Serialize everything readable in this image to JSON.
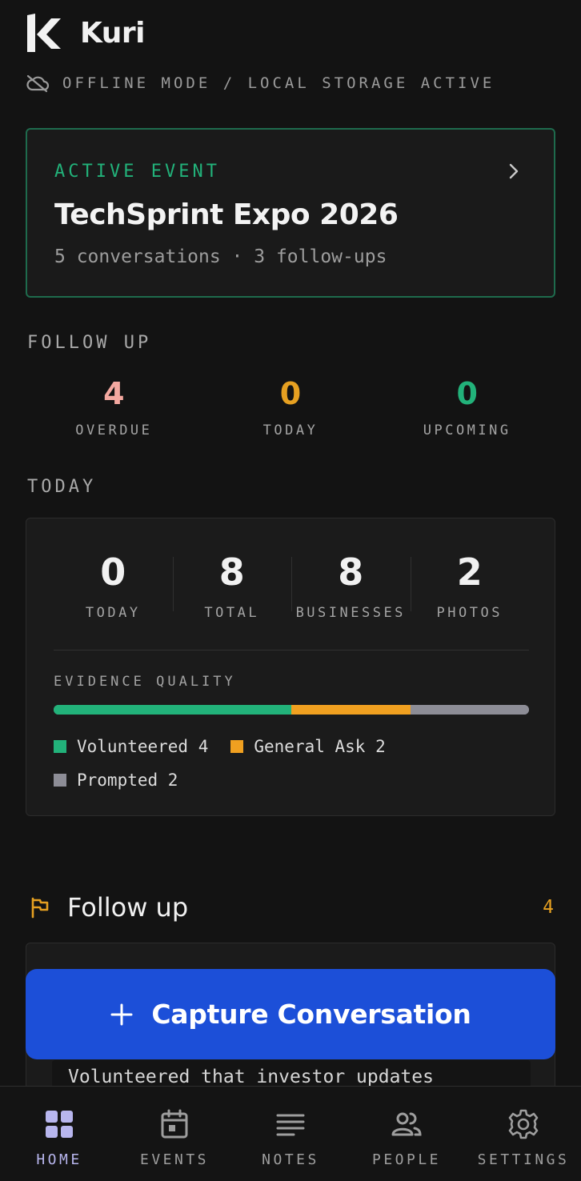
{
  "app": {
    "name": "Kuri"
  },
  "status": {
    "offline_text": "OFFLINE MODE / LOCAL STORAGE ACTIVE"
  },
  "active_event": {
    "eyebrow": "ACTIVE EVENT",
    "title": "TechSprint Expo 2026",
    "meta": "5 conversations · 3 follow-ups"
  },
  "follow_up_summary": {
    "label": "FOLLOW UP",
    "stats": [
      {
        "value": "4",
        "label": "OVERDUE",
        "color": "#f4a8a0"
      },
      {
        "value": "0",
        "label": "TODAY",
        "color": "#e6a021"
      },
      {
        "value": "0",
        "label": "UPCOMING",
        "color": "#22b27a"
      }
    ]
  },
  "today": {
    "label": "TODAY",
    "stats": [
      {
        "value": "0",
        "label": "TODAY"
      },
      {
        "value": "8",
        "label": "TOTAL"
      },
      {
        "value": "8",
        "label": "BUSINESSES"
      },
      {
        "value": "2",
        "label": "PHOTOS"
      }
    ],
    "evidence_quality": {
      "label": "EVIDENCE QUALITY",
      "segments": [
        {
          "name": "Volunteered",
          "count": 4,
          "text": "Volunteered 4",
          "color": "#22b27a"
        },
        {
          "name": "General Ask",
          "count": 2,
          "text": "General Ask 2",
          "color": "#f0a020"
        },
        {
          "name": "Prompted",
          "count": 2,
          "text": "Prompted 2",
          "color": "#8d8d96"
        }
      ]
    }
  },
  "follow_up_list": {
    "title": "Follow up",
    "count": "4",
    "first_note": "Volunteered that investor updates"
  },
  "capture_button": {
    "label": "Capture Conversation"
  },
  "nav": {
    "items": [
      {
        "label": "HOME",
        "icon": "grid-icon",
        "active": true
      },
      {
        "label": "EVENTS",
        "icon": "calendar-icon",
        "active": false
      },
      {
        "label": "NOTES",
        "icon": "notes-icon",
        "active": false
      },
      {
        "label": "PEOPLE",
        "icon": "people-icon",
        "active": false
      },
      {
        "label": "SETTINGS",
        "icon": "gear-icon",
        "active": false
      }
    ]
  },
  "colors": {
    "background": "#131313",
    "accent_green": "#22b27a",
    "accent_orange": "#e6a021",
    "overdue": "#f4a8a0",
    "primary_button": "#1c4fd8",
    "nav_active": "#b8b6ee"
  }
}
